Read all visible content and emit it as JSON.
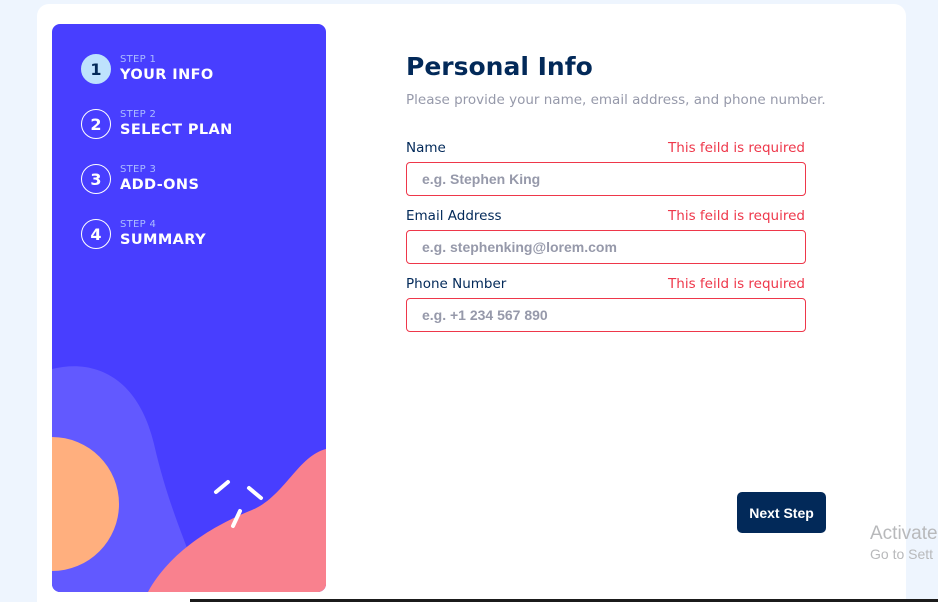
{
  "steps": [
    {
      "number": "1",
      "small": "STEP 1",
      "label": "YOUR INFO",
      "active": true
    },
    {
      "number": "2",
      "small": "STEP 2",
      "label": "SELECT PLAN",
      "active": false
    },
    {
      "number": "3",
      "small": "STEP 3",
      "label": "ADD-ONS",
      "active": false
    },
    {
      "number": "4",
      "small": "STEP 4",
      "label": "SUMMARY",
      "active": false
    }
  ],
  "form": {
    "title": "Personal Info",
    "subtitle": "Please provide your name, email address, and phone number.",
    "fields": [
      {
        "label": "Name",
        "error": "This feild is required",
        "value": "",
        "placeholder": "e.g. Stephen King"
      },
      {
        "label": "Email Address",
        "error": "This feild is required",
        "value": "",
        "placeholder": "e.g. stephenking@lorem.com"
      },
      {
        "label": "Phone Number",
        "error": "This feild is required",
        "value": "",
        "placeholder": "e.g. +1 234 567 890"
      }
    ],
    "next_label": "Next Step"
  },
  "watermark": {
    "line1": "Activate",
    "line2": "Go to Sett"
  },
  "colors": {
    "sidebar": "#483eff",
    "active_step": "#bee2fd",
    "primary": "#022959",
    "error": "#ee374a",
    "muted": "#9699aa",
    "blob_orange": "#ffaf7e",
    "blob_pink": "#f9818e",
    "blob_purple": "#6259ff"
  }
}
